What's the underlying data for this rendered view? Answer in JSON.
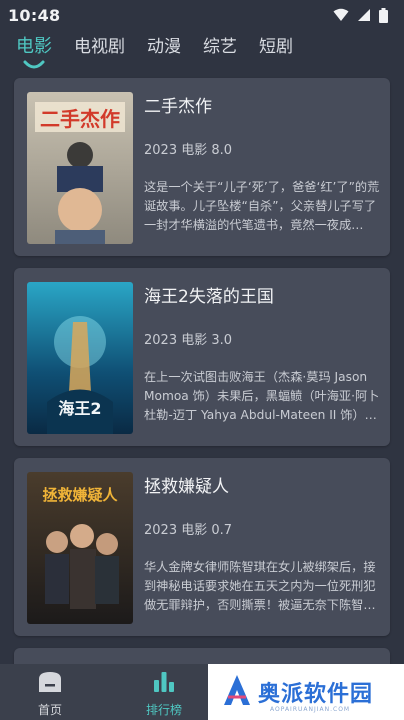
{
  "status_bar": {
    "time": "10:48"
  },
  "tabs": [
    {
      "label": "电影",
      "active": true
    },
    {
      "label": "电视剧",
      "active": false
    },
    {
      "label": "动漫",
      "active": false
    },
    {
      "label": "综艺",
      "active": false
    },
    {
      "label": "短剧",
      "active": false
    }
  ],
  "movies": [
    {
      "title": "二手杰作",
      "meta": "2023 电影 8.0",
      "description": "这是一个关于“儿子‘死’了，爸爸‘红’了”的荒诞故事。儿子坠楼“自杀”，父亲替儿子写了一封才华横溢的代笔遗书，竟然一夜成名……马黄泼是位高中语文老师…",
      "poster_text": "二手杰作"
    },
    {
      "title": "海王2失落的王国",
      "meta": "2023 电影 3.0",
      "description": "在上一次试图击败海王（杰森·莫玛 Jason Momoa 饰）未果后，黑蝠鲼（叶海亚·阿卜杜勒-迈丁 Yahya Abdul-Mateen II 饰）依然不甘放弃为父报仇…",
      "poster_text": "海王2"
    },
    {
      "title": "拯救嫌疑人",
      "meta": "2023 电影 0.7",
      "description": "华人金牌女律师陈智琪在女儿被绑架后，接到神秘电话要求她在五天之内为一位死刑犯做无罪辩护，否则撕票！被逼无奈下陈智琪联手警察金志展开调…",
      "poster_text": "拯救嫌疑人"
    }
  ],
  "bottom_nav": [
    {
      "label": "首页",
      "icon": "home-icon",
      "active": false
    },
    {
      "label": "排行榜",
      "icon": "ranking-icon",
      "active": true
    }
  ],
  "watermark": {
    "text": "奥派软件园",
    "sub": "AOPAIRUANJIAN.COM"
  },
  "colors": {
    "accent": "#4fc7c2",
    "background": "#2f3441",
    "card": "#474c5a"
  }
}
